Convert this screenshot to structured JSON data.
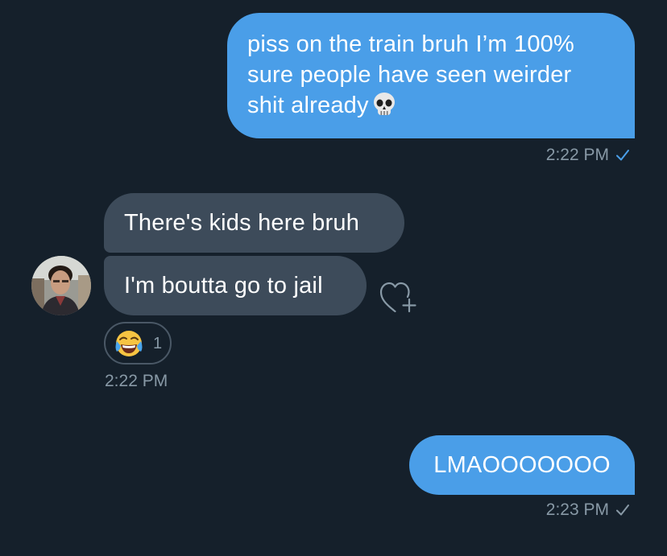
{
  "messages": [
    {
      "id": "m1",
      "direction": "outgoing",
      "lines": [
        "piss on the train bruh I’m 100%",
        "sure people have seen weirder",
        "shit already"
      ],
      "emoji": "skull",
      "time": "2:22 PM",
      "read_receipt": "seen"
    },
    {
      "id": "m2",
      "direction": "incoming",
      "text": "There's kids here bruh"
    },
    {
      "id": "m3",
      "direction": "incoming",
      "text": "I'm boutta go to jail",
      "reaction": {
        "emoji": "face-with-tears-of-joy",
        "count": "1"
      },
      "time": "2:22 PM"
    },
    {
      "id": "m4",
      "direction": "outgoing",
      "text": "LMAOOOOOOO",
      "time": "2:23 PM",
      "read_receipt": "sent"
    }
  ],
  "colors": {
    "background": "#15202b",
    "sent_bubble": "#4a9ee8",
    "received_bubble": "#3d4b5a",
    "timestamp": "#8899a6",
    "check_seen": "#4a9ee8",
    "check_sent": "#8899a6"
  },
  "icons": {
    "react_button": "heart-plus-icon",
    "read_check": "check-icon"
  }
}
